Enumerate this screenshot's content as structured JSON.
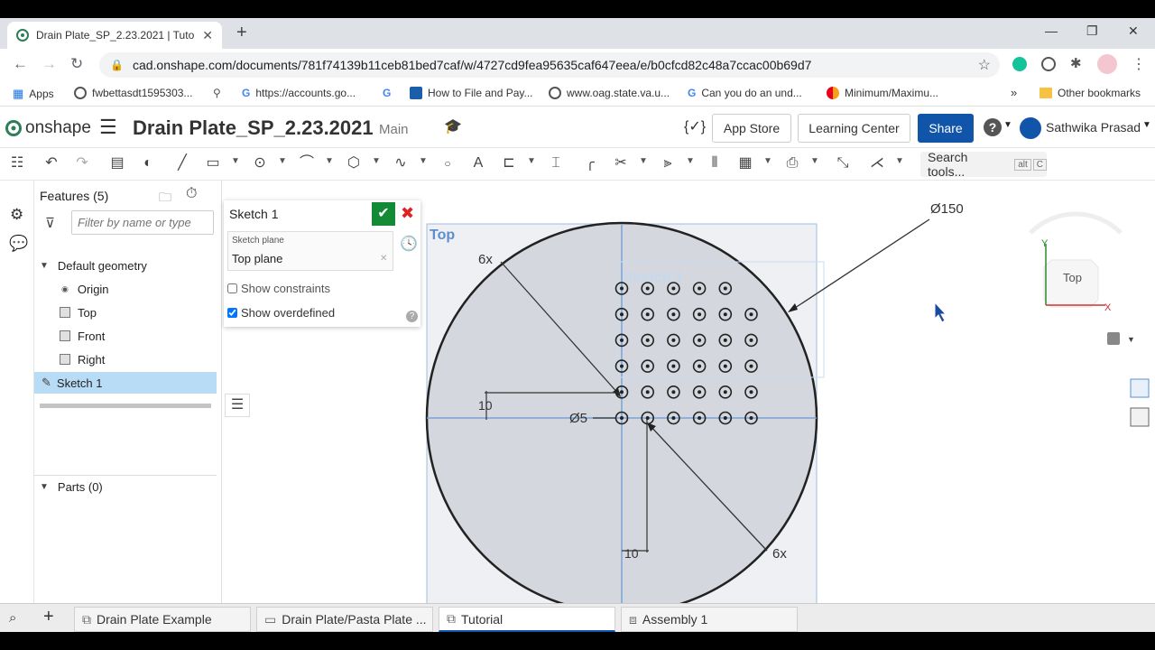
{
  "browser": {
    "tab_title": "Drain Plate_SP_2.23.2021 | Tutori",
    "url": "cad.onshape.com/documents/781f74139b11ceb81bed7caf/w/4727cd9fea95635caf647eea/e/b0cfcd82c48a7ccac00b69d7",
    "bookmarks": [
      "Apps",
      "fwbettasdt1595303...",
      "https://accounts.go...",
      "How to File and Pay...",
      "www.oag.state.va.u...",
      "Can you do an und...",
      "Minimum/Maximu..."
    ],
    "more_bookmarks": "»",
    "other_bookmarks": "Other bookmarks"
  },
  "header": {
    "logo_text": "onshape",
    "doc_title": "Drain Plate_SP_2.23.2021",
    "branch": "Main",
    "app_store": "App Store",
    "learning_center": "Learning Center",
    "share": "Share",
    "user_name": "Sathwika Prasad"
  },
  "toolbar": {
    "search_label": "Search tools...",
    "search_kbd_1": "alt",
    "search_kbd_2": "C"
  },
  "features": {
    "title": "Features (5)",
    "filter_placeholder": "Filter by name or type",
    "default_geometry": "Default geometry",
    "items": [
      "Origin",
      "Top",
      "Front",
      "Right"
    ],
    "selected": "Sketch 1",
    "parts": "Parts (0)"
  },
  "sketch_dialog": {
    "title": "Sketch 1",
    "plane_label": "Sketch plane",
    "plane_value": "Top plane",
    "show_constraints": "Show constraints",
    "show_overdefined": "Show overdefined",
    "show_constraints_checked": false,
    "show_overdefined_checked": true
  },
  "viewport": {
    "plane_label": "Top",
    "ghost_label": "Sketch 1",
    "dim_diameter": "Ø150",
    "dim_6x_top": "6x",
    "dim_6x_bottom": "6x",
    "dim_10_left": "10",
    "dim_10_bottom": "10",
    "dim_hole": "Ø5",
    "viewcube_face": "Top",
    "axis_x": "X",
    "axis_y": "Y"
  },
  "bottom_tabs": [
    "Drain Plate Example",
    "Drain Plate/Pasta Plate ...",
    "Tutorial",
    "Assembly 1"
  ],
  "colors": {
    "accent": "#1155aa",
    "ok_green": "#138a36",
    "selection": "#b9dcf6",
    "plane_fill": "#d4d8de",
    "plane_label": "#5b8fd0"
  }
}
